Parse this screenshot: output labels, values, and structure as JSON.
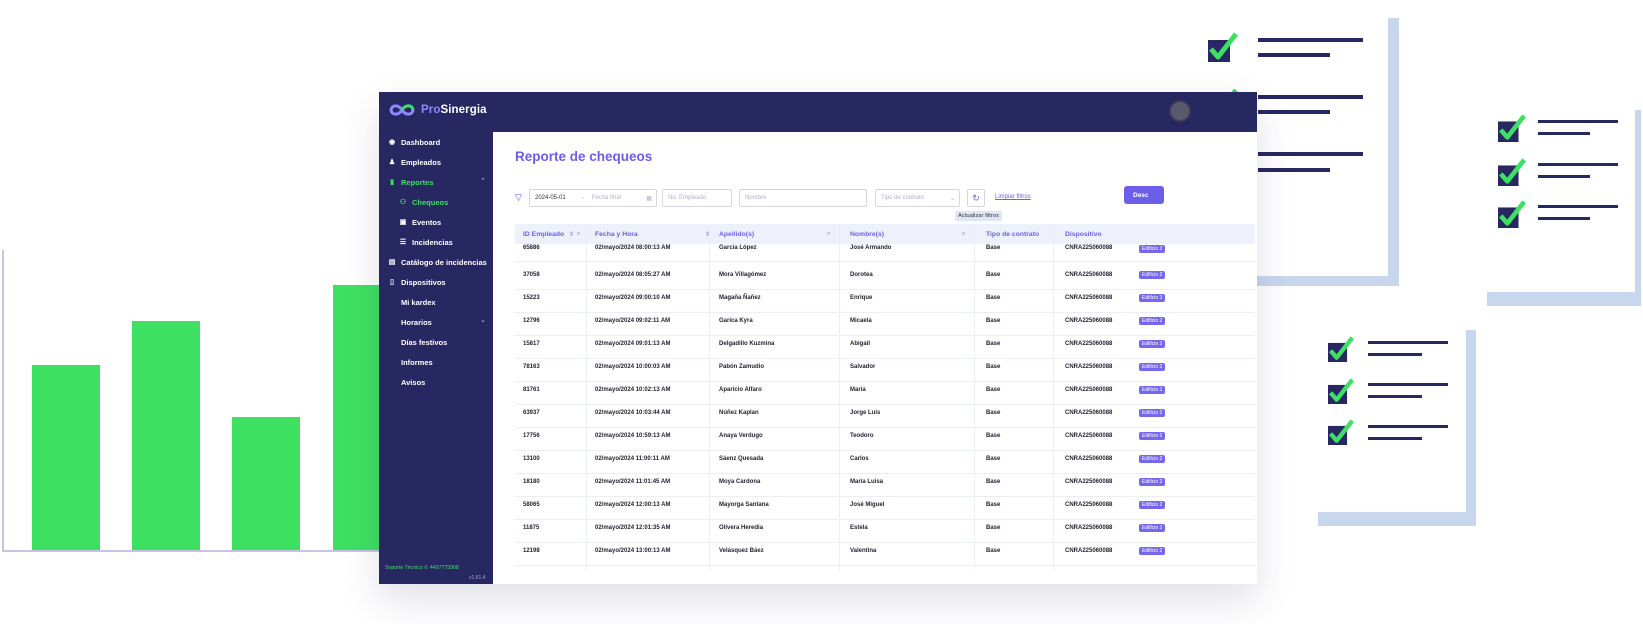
{
  "app": {
    "brand_pro": "Pro",
    "brand_rest": "Sinergia",
    "colors": {
      "navy": "#272762",
      "accent": "#6c5ee8",
      "green": "#3ee062",
      "badge": "#7668ee"
    }
  },
  "sidebar": {
    "items": [
      {
        "label": "Dashboard",
        "icon": "dashboard-icon"
      },
      {
        "label": "Empleados",
        "icon": "users-icon"
      },
      {
        "label": "Reportes",
        "icon": "report-icon"
      },
      {
        "label": "Chequeos",
        "icon": "checks-icon"
      },
      {
        "label": "Eventos",
        "icon": "calendar-icon"
      },
      {
        "label": "Incidencias",
        "icon": "list-icon"
      },
      {
        "label": "Catálogo de incidencias",
        "icon": "book-icon"
      },
      {
        "label": "Dispositivos",
        "icon": "device-icon"
      },
      {
        "label": "Mi kardex",
        "icon": "kardex-icon"
      },
      {
        "label": "Horarios",
        "icon": "clock-icon"
      },
      {
        "label": "Días festivos",
        "icon": "holiday-icon"
      },
      {
        "label": "Informes",
        "icon": "info-icon"
      },
      {
        "label": "Avisos",
        "icon": "notice-icon"
      }
    ],
    "support": "Soporte Técnico  ✆ 4497775908",
    "version": "v1.61.4"
  },
  "page": {
    "title": "Reporte de chequeos"
  },
  "filters": {
    "start_date": "2024-05-01",
    "end_date_placeholder": "Fecha final",
    "employee_placeholder": "No. Empleado",
    "name_placeholder": "Nombre",
    "contract_placeholder": "Tipo de contrato",
    "clear_label": "Limpiar filtros",
    "refresh_tooltip": "Actualizar filtros",
    "download_label": "Desc"
  },
  "table": {
    "headers": [
      "ID Empleado",
      "Fecha y Hora",
      "Apellido(s)",
      "Nombre(s)",
      "Tipo de contrato",
      "Dispositivo"
    ],
    "rows": [
      {
        "id": "65886",
        "datetime": "02/mayo/2024 08:00:13 AM",
        "surname": "García López",
        "name": "José Armando",
        "contract": "Base",
        "device": "CNRA225060088",
        "badge": "Edificio 2"
      },
      {
        "id": "37058",
        "datetime": "02/mayo/2024 08:05:27 AM",
        "surname": "Mora Villagómez",
        "name": "Dorotea",
        "contract": "Base",
        "device": "CNRA225060088",
        "badge": "Edificio 2"
      },
      {
        "id": "15223",
        "datetime": "02/mayo/2024 09:00:10 AM",
        "surname": "Magaña Ñañez",
        "name": "Enrique",
        "contract": "Base",
        "device": "CNRA225060088",
        "badge": "Edificio 3"
      },
      {
        "id": "12796",
        "datetime": "02/mayo/2024 09:02:11 AM",
        "surname": "Garica Kyra",
        "name": "Micaela",
        "contract": "Base",
        "device": "CNRA225060088",
        "badge": "Edificio 2"
      },
      {
        "id": "15817",
        "datetime": "02/mayo/2024 09:01:13 AM",
        "surname": "Delgadillo Kuzmina",
        "name": "Abigail",
        "contract": "Base",
        "device": "CNRA225060088",
        "badge": "Edificio 2"
      },
      {
        "id": "78163",
        "datetime": "02/mayo/2024 10:00:03 AM",
        "surname": "Pabón Zamudio",
        "name": "Salvador",
        "contract": "Base",
        "device": "CNRA225060088",
        "badge": "Edificio 2"
      },
      {
        "id": "81761",
        "datetime": "02/mayo/2024 10:02:13 AM",
        "surname": "Aparicio Alfaro",
        "name": "María",
        "contract": "Base",
        "device": "CNRA225060088",
        "badge": "Edificio 2"
      },
      {
        "id": "63937",
        "datetime": "02/mayo/2024 10:03:44 AM",
        "surname": "Núñez Kaplan",
        "name": "Jorge Luis",
        "contract": "Base",
        "device": "CNRA225060088",
        "badge": "Edificio 2"
      },
      {
        "id": "17756",
        "datetime": "02/mayo/2024 10:59:13 AM",
        "surname": "Anaya Verdugo",
        "name": "Teodoro",
        "contract": "Base",
        "device": "CNRA225060088",
        "badge": "Edificio 2"
      },
      {
        "id": "13100",
        "datetime": "02/mayo/2024 11:00:11 AM",
        "surname": "Sáenz Quesada",
        "name": "Carlos",
        "contract": "Base",
        "device": "CNRA225060088",
        "badge": "Edificio 2"
      },
      {
        "id": "18180",
        "datetime": "02/mayo/2024 11:01:45 AM",
        "surname": "Moya Cardona",
        "name": "María Luisa",
        "contract": "Base",
        "device": "CNRA225060088",
        "badge": "Edificio 2"
      },
      {
        "id": "58065",
        "datetime": "02/mayo/2024 12:00:13 AM",
        "surname": "Mayorga Santana",
        "name": "José Miguel",
        "contract": "Base",
        "device": "CNRA225060088",
        "badge": "Edificio 2"
      },
      {
        "id": "11875",
        "datetime": "02/mayo/2024 12:01:35 AM",
        "surname": "Olivera Heredia",
        "name": "Estela",
        "contract": "Base",
        "device": "CNRA225060088",
        "badge": "Edificio 2"
      },
      {
        "id": "12198",
        "datetime": "02/mayo/2024 13:00:13 AM",
        "surname": "Velásquez Báez",
        "name": "Valentina",
        "contract": "Base",
        "device": "CNRA225060088",
        "badge": "Edificio 2"
      }
    ]
  }
}
